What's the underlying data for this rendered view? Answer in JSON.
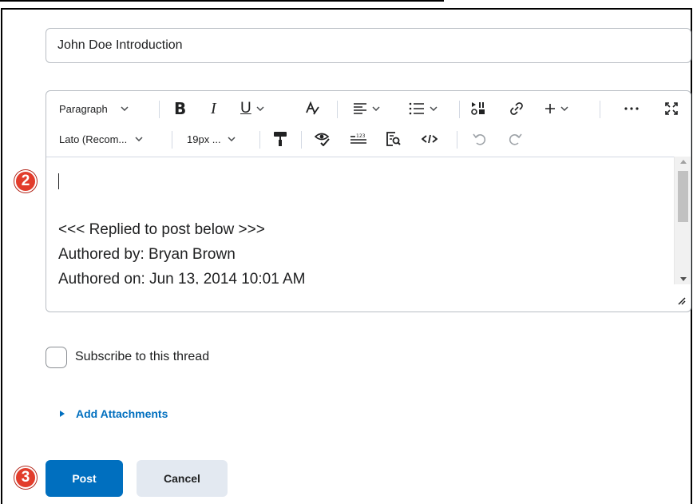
{
  "subject": {
    "value": "John Doe Introduction"
  },
  "toolbar": {
    "format_block": "Paragraph",
    "font_family": "Lato (Recom...",
    "font_size": "19px ..."
  },
  "editor": {
    "lines": [
      "<<< Replied to post below >>>",
      "Authored by: Bryan Brown",
      "Authored on: Jun 13, 2014 10:01 AM"
    ]
  },
  "annotations": {
    "step2": "2",
    "step3": "3",
    "badge_color": "#e23c2b"
  },
  "subscribe": {
    "label": "Subscribe to this thread",
    "checked": false
  },
  "attachments": {
    "label": "Add Attachments"
  },
  "buttons": {
    "post": "Post",
    "cancel": "Cancel",
    "post_color": "#006fbf"
  },
  "icons": {
    "toolbar_row1": [
      "chevron-down-icon",
      "bold-icon",
      "italic-icon",
      "underline-icon",
      "text-color-icon",
      "align-icon",
      "bullet-list-icon",
      "insert-stuff-icon",
      "link-icon",
      "plus-icon",
      "more-icon",
      "fullscreen-icon"
    ],
    "toolbar_row2": [
      "format-painter-icon",
      "accessibility-check-icon",
      "word-count-icon",
      "find-replace-icon",
      "source-code-icon",
      "undo-icon",
      "redo-icon"
    ]
  }
}
